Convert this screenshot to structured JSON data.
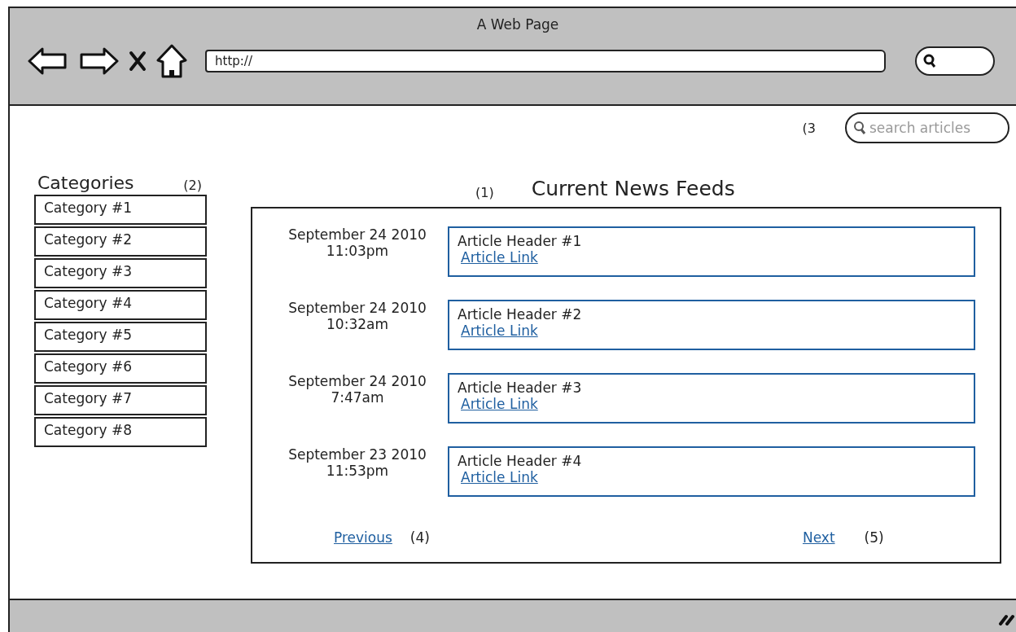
{
  "window": {
    "title": "A Web Page"
  },
  "toolbar": {
    "address": "http://"
  },
  "page": {
    "search_note": "(3",
    "search": {
      "placeholder": "search articles"
    },
    "categories": {
      "title": "Categories",
      "note": "(2)",
      "items": [
        "Category #1",
        "Category #2",
        "Category #3",
        "Category #4",
        "Category #5",
        "Category #6",
        "Category #7",
        "Category #8"
      ]
    },
    "feed": {
      "note": "(1)",
      "title": "Current News Feeds",
      "articles": [
        {
          "date": "September 24 2010",
          "time": "11:03pm",
          "header": "Article Header #1",
          "link": "Article Link"
        },
        {
          "date": "September 24 2010",
          "time": "10:32am",
          "header": "Article Header #2",
          "link": "Article Link"
        },
        {
          "date": "September 24 2010",
          "time": "7:47am",
          "header": "Article Header #3",
          "link": "Article Link"
        },
        {
          "date": "September 23 2010",
          "time": "11:53pm",
          "header": "Article Header #4",
          "link": "Article Link"
        }
      ],
      "pager": {
        "previous": "Previous",
        "previous_note": "(4)",
        "next": "Next",
        "next_note": "(5)"
      }
    }
  }
}
